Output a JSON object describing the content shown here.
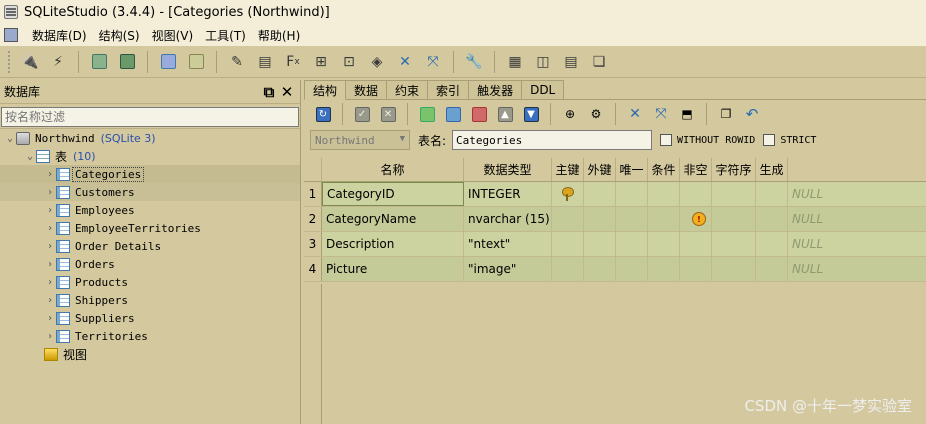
{
  "window": {
    "title": "SQLiteStudio (3.4.4) - [Categories (Northwind)]"
  },
  "menu": [
    "数据库(D)",
    "结构(S)",
    "视图(V)",
    "工具(T)",
    "帮助(H)"
  ],
  "left_panel": {
    "title": "数据库",
    "filter_placeholder": "按名称过滤",
    "database": {
      "name": "Northwind",
      "type": "(SQLite 3)"
    },
    "tables_label": "表",
    "tables_count": "(10)",
    "tables": [
      "Categories",
      "Customers",
      "Employees",
      "EmployeeTerritories",
      "Order Details",
      "Orders",
      "Products",
      "Shippers",
      "Suppliers",
      "Territories"
    ],
    "views_label": "视图"
  },
  "tabs": [
    "结构",
    "数据",
    "约束",
    "索引",
    "触发器",
    "DDL"
  ],
  "namebar": {
    "database": "Northwind",
    "table_name_label": "表名:",
    "table_name": "Categories",
    "without_rowid": "WITHOUT ROWID",
    "strict": "STRICT"
  },
  "columns_header": [
    "名称",
    "数据类型",
    "主键",
    "外键",
    "唯一",
    "条件",
    "非空",
    "字符序",
    "生成",
    ""
  ],
  "columns": [
    {
      "num": "1",
      "name": "CategoryID",
      "type": "INTEGER",
      "pk": true,
      "notnull": false,
      "default": "NULL"
    },
    {
      "num": "2",
      "name": "CategoryName",
      "type": "nvarchar (15)",
      "pk": false,
      "notnull": true,
      "default": "NULL"
    },
    {
      "num": "3",
      "name": "Description",
      "type": "\"ntext\"",
      "pk": false,
      "notnull": false,
      "default": "NULL"
    },
    {
      "num": "4",
      "name": "Picture",
      "type": "\"image\"",
      "pk": false,
      "notnull": false,
      "default": "NULL"
    }
  ],
  "watermark": "CSDN @十年一梦实验室"
}
